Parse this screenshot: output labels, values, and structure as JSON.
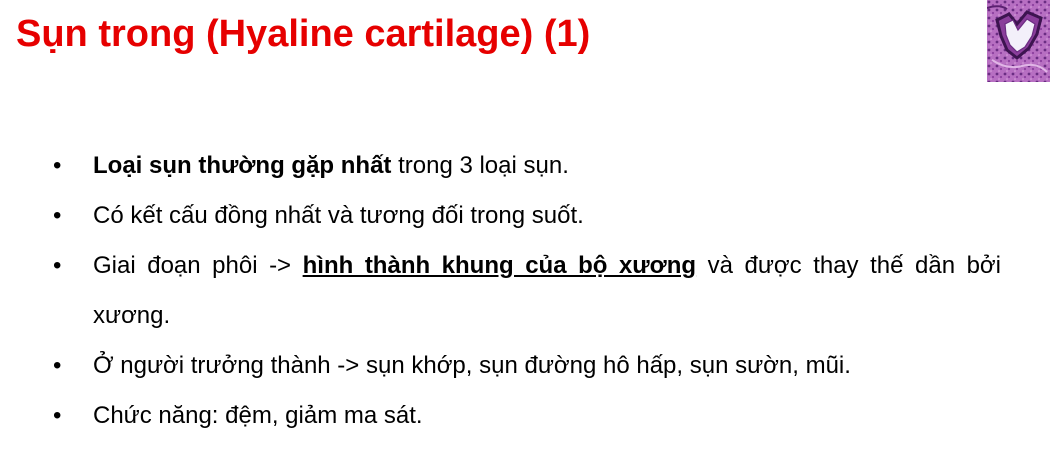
{
  "slide": {
    "title": "Sụn trong (Hyaline cartilage) (1)",
    "title_color": "#e60000",
    "thumbnail_icon": "hyaline-cartilage-micrograph-icon",
    "bullets": [
      {
        "marker": "•",
        "bold": "Loại sụn thường gặp nhất",
        "rest": " trong 3 loại sụn."
      },
      {
        "marker": "•",
        "text": "Có kết cấu đồng nhất và tương đối trong suốt."
      },
      {
        "marker": "•",
        "before": "Giai đoạn phôi -> ",
        "emphasis": "hình thành khung của bộ xương",
        "after": " và được thay thế dần bởi xương."
      },
      {
        "marker": "•",
        "text": "Ở người trưởng thành -> sụn khớp, sụn đường hô hấp, sụn sườn, mũi."
      },
      {
        "marker": "•",
        "text": "Chức năng: đệm, giảm ma sát."
      }
    ]
  }
}
